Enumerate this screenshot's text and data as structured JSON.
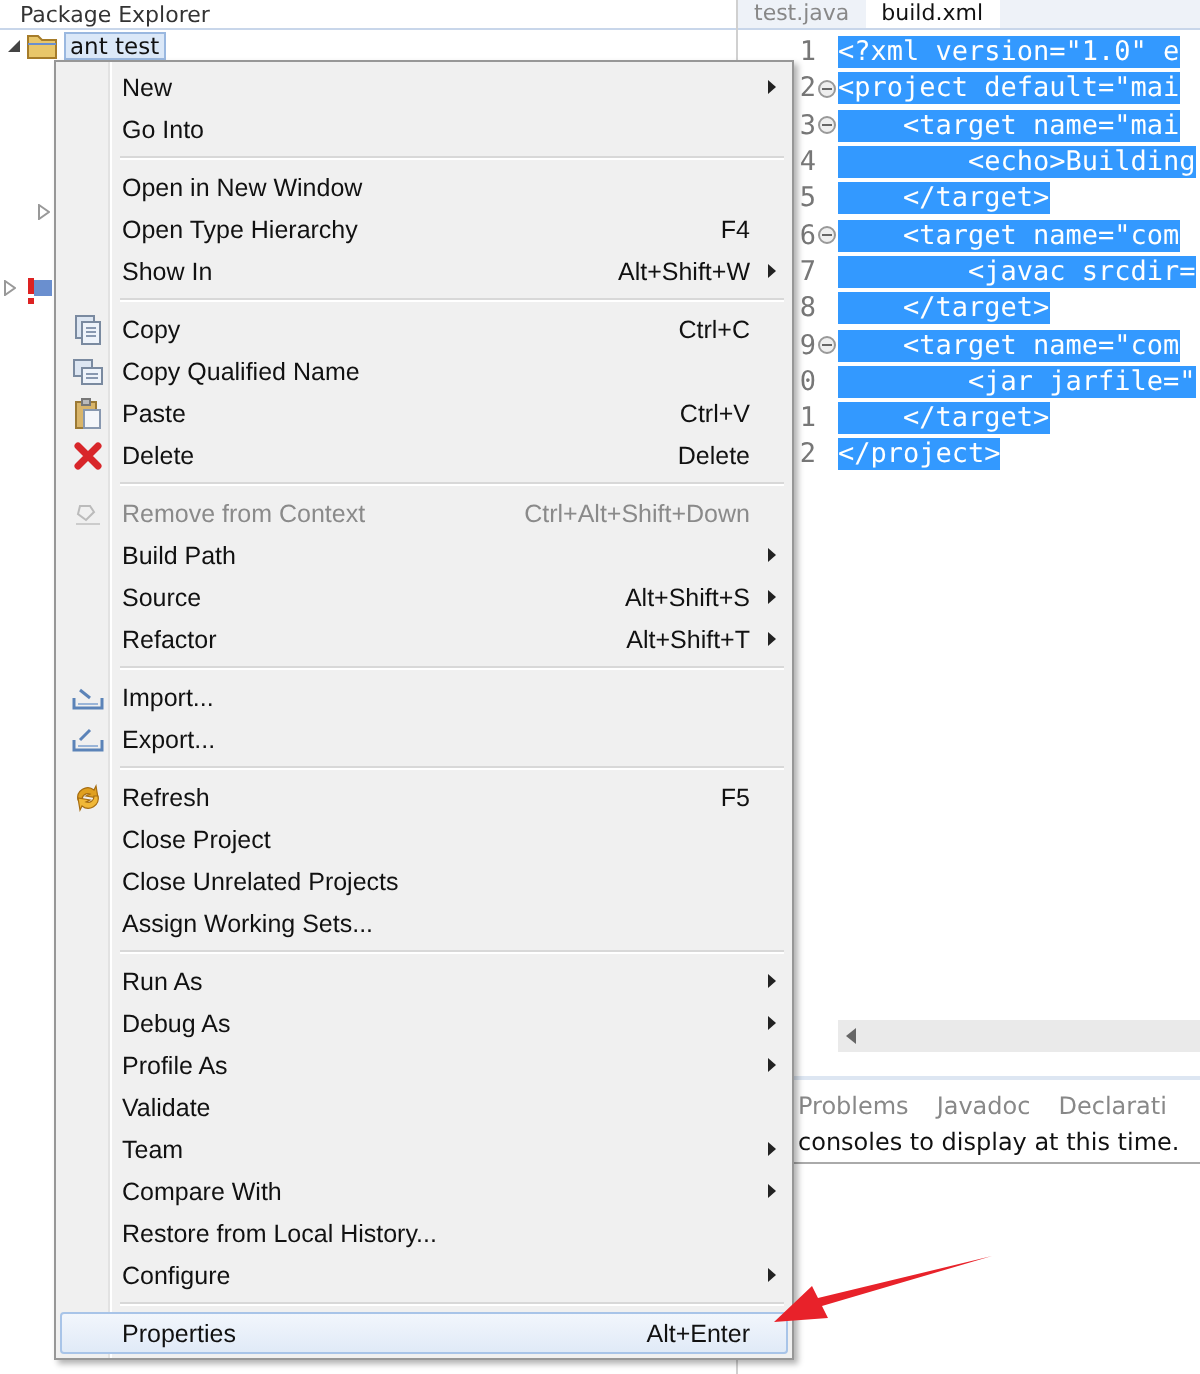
{
  "explorer": {
    "title": "Package Explorer",
    "tree": [
      {
        "label": "ant test",
        "selected": true
      }
    ]
  },
  "editor": {
    "tabs": [
      {
        "label": "test.java",
        "selected": false
      },
      {
        "label": "build.xml",
        "selected": true
      }
    ],
    "lines": [
      {
        "number": "1",
        "code": "<?xml version=\"1.0\" e",
        "fold": false
      },
      {
        "number": "2",
        "code": "<project default=\"mai",
        "fold": true
      },
      {
        "number": "3",
        "code": "    <target name=\"mai",
        "fold": true
      },
      {
        "number": "4",
        "code": "        <echo>Building",
        "fold": false
      },
      {
        "number": "5",
        "code": "    </target>",
        "fold": false
      },
      {
        "number": "6",
        "code": "    <target name=\"com",
        "fold": true
      },
      {
        "number": "7",
        "code": "        <javac srcdir=",
        "fold": false
      },
      {
        "number": "8",
        "code": "    </target>",
        "fold": false
      },
      {
        "number": "9",
        "code": "    <target name=\"com",
        "fold": true
      },
      {
        "number": "0",
        "code": "        <jar jarfile=\"",
        "fold": false
      },
      {
        "number": "1",
        "code": "    </target>",
        "fold": false
      },
      {
        "number": "2",
        "code": "</project>",
        "fold": false
      }
    ]
  },
  "bottom_panel": {
    "tabs": [
      {
        "label": "Problems",
        "selected": false
      },
      {
        "label": "Javadoc",
        "selected": false
      },
      {
        "label": "Declarati",
        "selected": false
      }
    ],
    "message": "consoles to display at this time."
  },
  "context_menu": {
    "sections": [
      [
        {
          "label": "New",
          "submenu": true,
          "selected": false,
          "disabled": false
        },
        {
          "label": "Go Into",
          "submenu": false,
          "selected": false,
          "disabled": false
        }
      ],
      [
        {
          "label": "Open in New Window",
          "submenu": false,
          "selected": false,
          "disabled": false
        },
        {
          "label": "Open Type Hierarchy",
          "shortcut": "F4",
          "submenu": false,
          "selected": false,
          "disabled": false
        },
        {
          "label": "Show In",
          "shortcut": "Alt+Shift+W",
          "submenu": true,
          "selected": false,
          "disabled": false
        }
      ],
      [
        {
          "label": "Copy",
          "shortcut": "Ctrl+C",
          "kind": "copy",
          "submenu": false,
          "selected": false,
          "disabled": false
        },
        {
          "label": "Copy Qualified Name",
          "kind": "copy-name",
          "submenu": false,
          "selected": false,
          "disabled": false
        },
        {
          "label": "Paste",
          "shortcut": "Ctrl+V",
          "kind": "paste",
          "submenu": false,
          "selected": false,
          "disabled": false
        },
        {
          "label": "Delete",
          "shortcut": "Delete",
          "kind": "delete",
          "submenu": false,
          "selected": false,
          "disabled": false
        }
      ],
      [
        {
          "label": "Remove from Context",
          "shortcut": "Ctrl+Alt+Shift+Down",
          "kind": "remove",
          "submenu": false,
          "selected": false,
          "disabled": true
        },
        {
          "label": "Build Path",
          "submenu": true,
          "selected": false,
          "disabled": false
        },
        {
          "label": "Source",
          "shortcut": "Alt+Shift+S",
          "submenu": true,
          "selected": false,
          "disabled": false
        },
        {
          "label": "Refactor",
          "shortcut": "Alt+Shift+T",
          "submenu": true,
          "selected": false,
          "disabled": false
        }
      ],
      [
        {
          "label": "Import...",
          "kind": "import",
          "submenu": false,
          "selected": false,
          "disabled": false
        },
        {
          "label": "Export...",
          "kind": "export",
          "submenu": false,
          "selected": false,
          "disabled": false
        }
      ],
      [
        {
          "label": "Refresh",
          "shortcut": "F5",
          "kind": "refresh",
          "submenu": false,
          "selected": false,
          "disabled": false
        },
        {
          "label": "Close Project",
          "submenu": false,
          "selected": false,
          "disabled": false
        },
        {
          "label": "Close Unrelated Projects",
          "submenu": false,
          "selected": false,
          "disabled": false
        },
        {
          "label": "Assign Working Sets...",
          "submenu": false,
          "selected": false,
          "disabled": false
        }
      ],
      [
        {
          "label": "Run As",
          "submenu": true,
          "selected": false,
          "disabled": false
        },
        {
          "label": "Debug As",
          "submenu": true,
          "selected": false,
          "disabled": false
        },
        {
          "label": "Profile As",
          "submenu": true,
          "selected": false,
          "disabled": false
        },
        {
          "label": "Validate",
          "submenu": false,
          "selected": false,
          "disabled": false
        },
        {
          "label": "Team",
          "submenu": true,
          "selected": false,
          "disabled": false
        },
        {
          "label": "Compare With",
          "submenu": true,
          "selected": false,
          "disabled": false
        },
        {
          "label": "Restore from Local History...",
          "submenu": false,
          "selected": false,
          "disabled": false
        },
        {
          "label": "Configure",
          "submenu": true,
          "selected": false,
          "disabled": false
        }
      ],
      [
        {
          "label": "Properties",
          "shortcut": "Alt+Enter",
          "submenu": false,
          "selected": true,
          "disabled": false
        }
      ]
    ]
  }
}
